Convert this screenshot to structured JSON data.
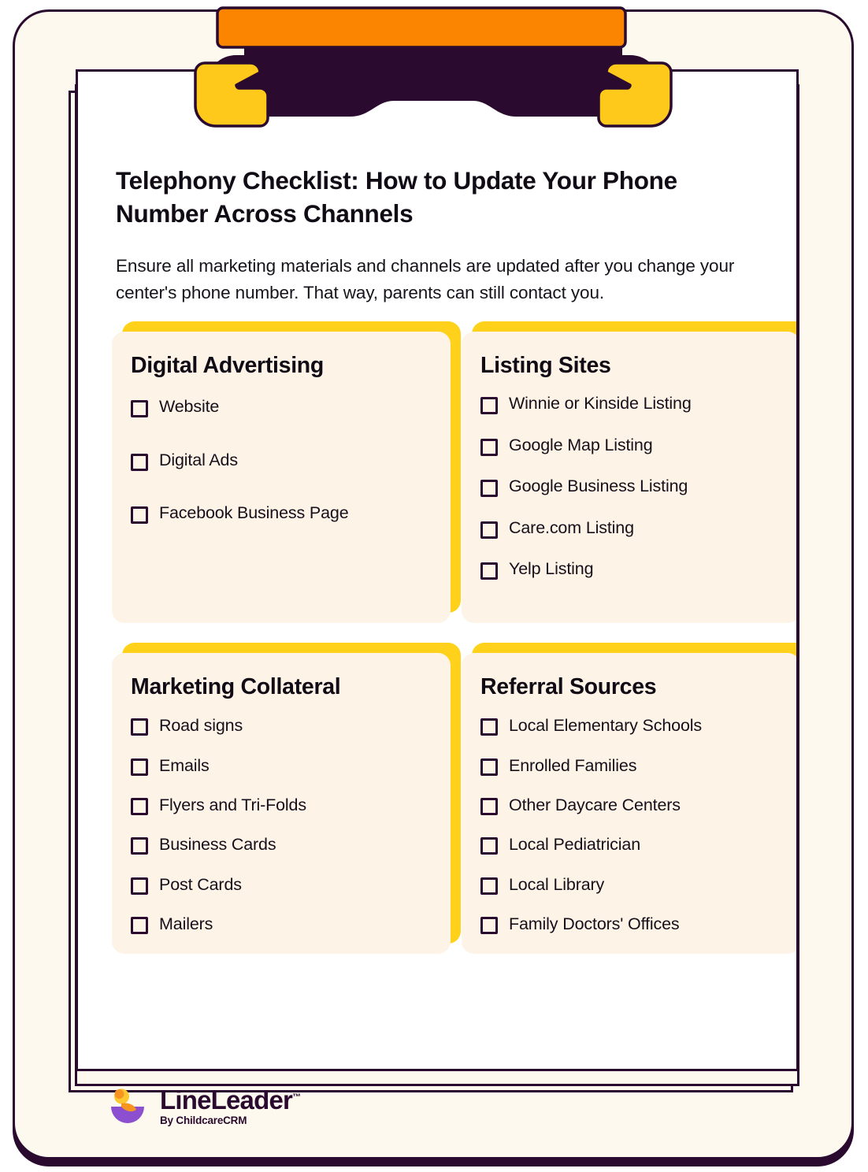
{
  "document": {
    "title": "Telephony Checklist: How to Update Your Phone Number Across Channels",
    "intro": "Ensure all marketing materials and channels are updated after you change your center's phone number. That way, parents can still contact you."
  },
  "colors": {
    "clipboard_bg": "#FDF9EE",
    "page_bg": "#FFFFFF",
    "outline": "#2A0A2E",
    "accent_yellow": "#FFD11A",
    "accent_orange": "#FB8500",
    "card_bg": "#FDF3E7",
    "logo_purple": "#8B4FCF",
    "logo_orange": "#F79520",
    "logo_yellow": "#FDC830"
  },
  "sections": [
    {
      "id": "digital-advertising",
      "title": "Digital Advertising",
      "items": [
        "Website",
        "Digital Ads",
        "Facebook Business Page"
      ]
    },
    {
      "id": "listing-sites",
      "title": "Listing Sites",
      "items": [
        "Winnie or Kinside Listing",
        "Google Map Listing",
        "Google Business Listing",
        "Care.com Listing",
        "Yelp Listing"
      ]
    },
    {
      "id": "marketing-collateral",
      "title": "Marketing Collateral",
      "items": [
        "Road signs",
        "Emails",
        "Flyers and Tri-Folds",
        "Business Cards",
        "Post Cards",
        "Mailers"
      ]
    },
    {
      "id": "referral-sources",
      "title": "Referral Sources",
      "items": [
        "Local Elementary Schools",
        "Enrolled Families",
        "Other Daycare Centers",
        "Local Pediatrician",
        "Local Library",
        "Family Doctors' Offices"
      ]
    }
  ],
  "footer": {
    "brand": "LineLeader",
    "trademark": "™",
    "tagline": "By ChildcareCRM"
  }
}
